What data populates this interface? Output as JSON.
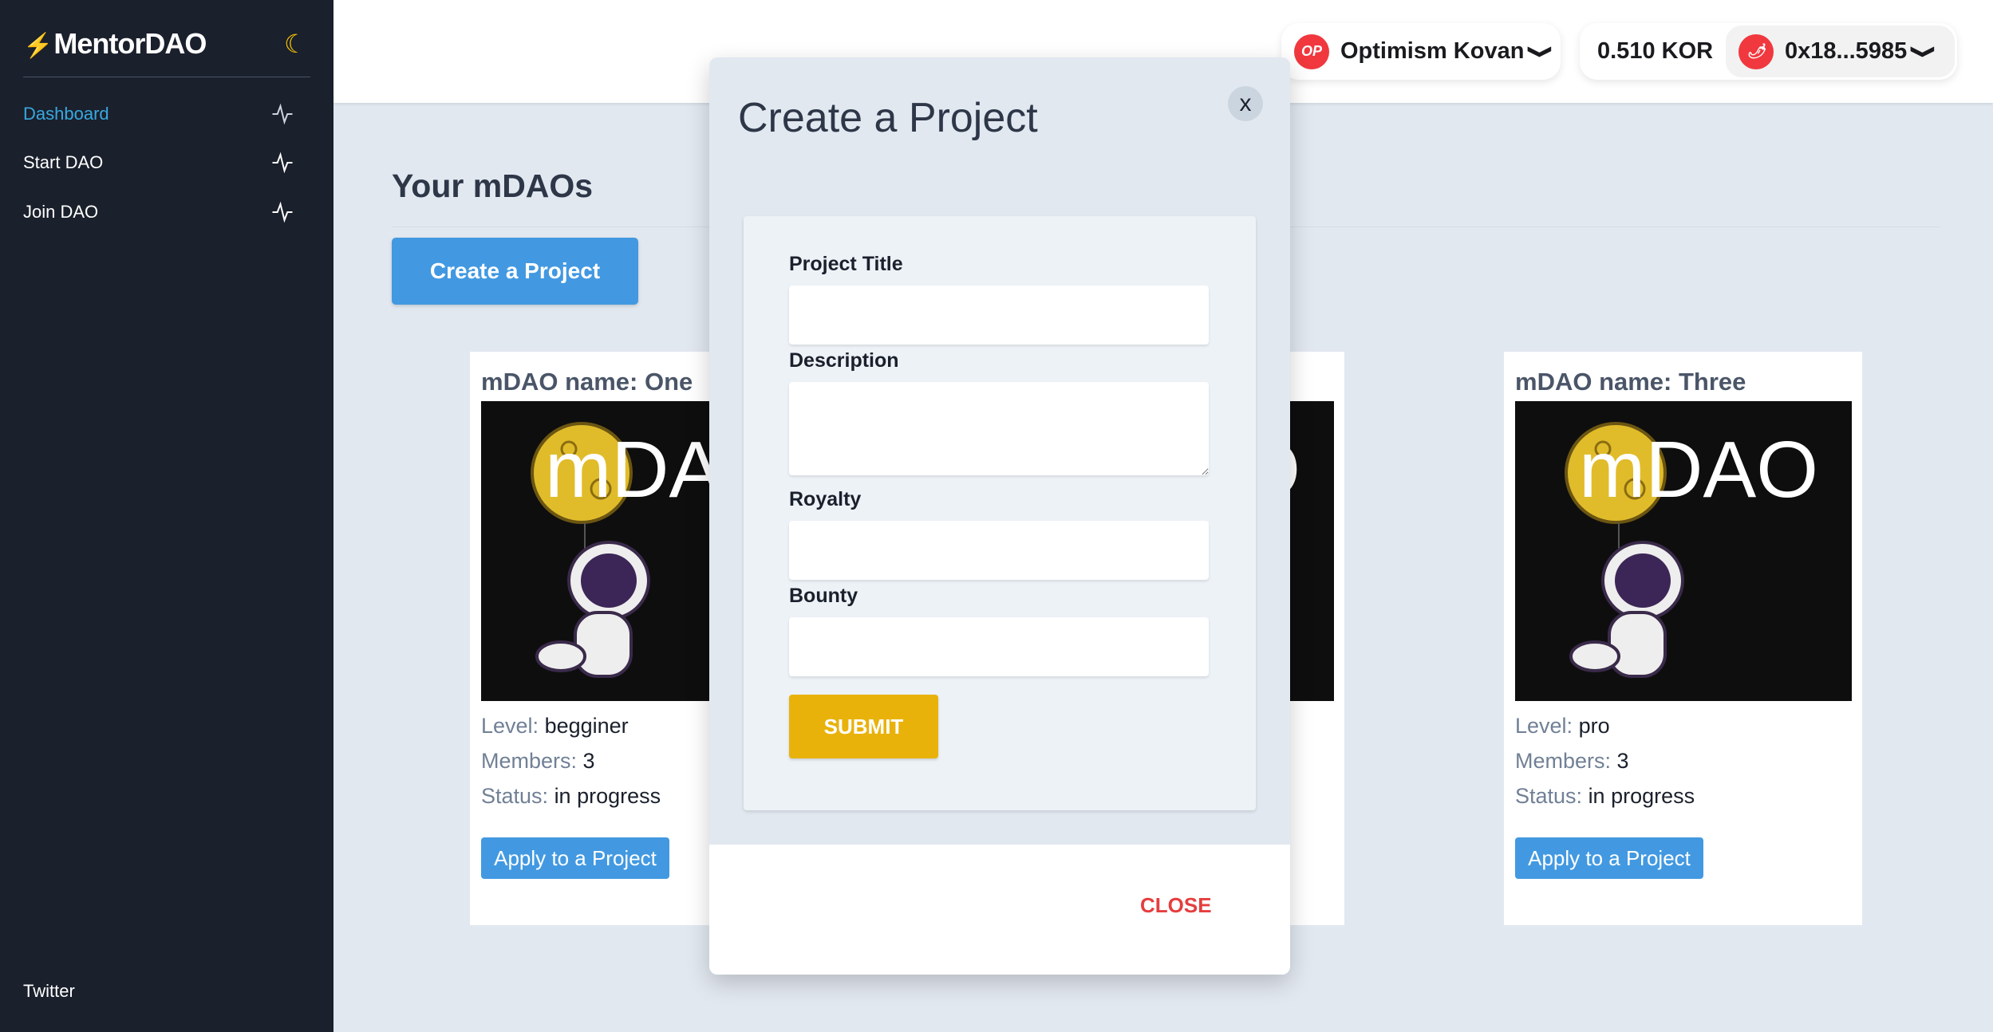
{
  "sidebar": {
    "logo": "MentorDAO",
    "items": [
      {
        "label": "Dashboard",
        "active": true
      },
      {
        "label": "Start DAO"
      },
      {
        "label": "Join DAO"
      }
    ],
    "footer": "Twitter"
  },
  "header": {
    "network": "Optimism Kovan",
    "network_badge": "OP",
    "balance": "0.510 KOR",
    "address": "0x18...5985"
  },
  "main": {
    "title": "Your mDAOs",
    "create_button": "Create a Project",
    "cards": [
      {
        "title": "mDAO name: One",
        "image_text": "mDAO",
        "level_label": "Level:",
        "level": "begginer",
        "members_label": "Members:",
        "members": "3",
        "status_label": "Status:",
        "status": "in progress",
        "apply": "Apply to a Project"
      },
      {
        "image_text": "mDAO"
      },
      {
        "title": "mDAO name: Three",
        "image_text": "mDAO",
        "level_label": "Level:",
        "level": "pro",
        "members_label": "Members:",
        "members": "3",
        "status_label": "Status:",
        "status": "in progress",
        "apply": "Apply to a Project"
      }
    ]
  },
  "modal": {
    "title": "Create a Project",
    "x": "x",
    "fields": [
      {
        "label": "Project Title",
        "value": ""
      },
      {
        "label": "Description",
        "value": ""
      },
      {
        "label": "Royalty",
        "value": ""
      },
      {
        "label": "Bounty",
        "value": ""
      }
    ],
    "submit": "SUBMIT",
    "close": "CLOSE"
  },
  "colors": {
    "sidebar": "#1a202c",
    "accent": "#4299e1",
    "active_nav": "#38a8e0",
    "submit": "#e9b20b",
    "close": "#e53e3e"
  }
}
